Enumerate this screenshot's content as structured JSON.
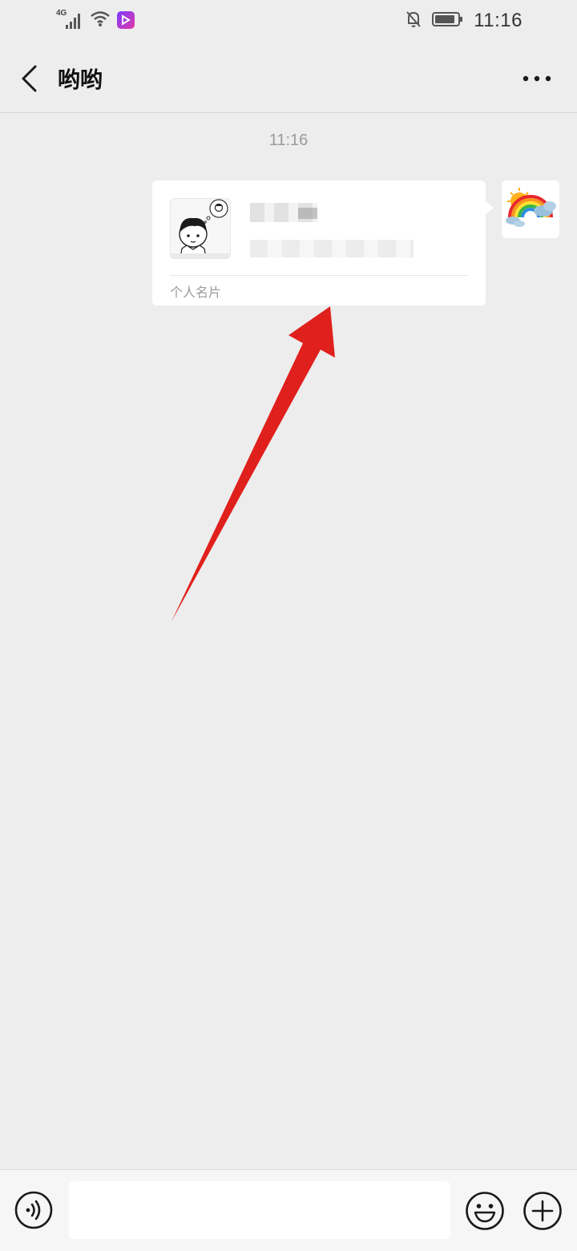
{
  "status_bar": {
    "network_label": "4G",
    "clock": "11:16",
    "icons": [
      "signal-icon",
      "wifi-icon",
      "app-badge-icon",
      "mute-bell-icon",
      "battery-icon"
    ]
  },
  "nav": {
    "title": "哟哟",
    "back_icon": "chevron-left-icon",
    "more_icon": "more-dots-icon"
  },
  "chat": {
    "timestamp": "11:16",
    "card": {
      "label": "个人名片",
      "avatar_icon": "cartoon-boy-avatar"
    },
    "user_avatar_icon": "rainbow-sun-avatar"
  },
  "annotation": {
    "arrow_color": "#e0201c"
  },
  "input_bar": {
    "input_value": "",
    "icons": [
      "voice-icon",
      "emoji-icon",
      "plus-icon"
    ]
  }
}
